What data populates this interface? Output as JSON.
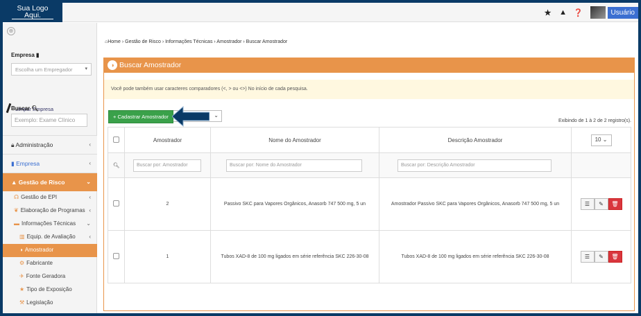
{
  "topbar": {
    "logo_line1": "Sua Logo",
    "logo_line2": "Aqui.",
    "icons": [
      "star-icon",
      "warning-icon",
      "help-icon"
    ],
    "user_label": "Usuário"
  },
  "sidebar": {
    "empresa_label": "Empresa",
    "empresa_select": "Escolha um Empregador",
    "limpar_label": "Limpar Empresa",
    "buscar_label": "Buscar",
    "buscar_placeholder": "Exemplo: Exame Clínico",
    "menu": {
      "admin": "Administração",
      "empresa": "Empresa",
      "gestao": "Gestão de Risco"
    },
    "submenu": [
      {
        "label": "Gestão de EPI",
        "icon": "headset-icon"
      },
      {
        "label": "Elaboração de Programas",
        "icon": "leaf-icon"
      },
      {
        "label": "Informações Técnicas",
        "icon": "folder-icon"
      },
      {
        "label": "Equip. de Avaliação",
        "icon": "chart-icon"
      },
      {
        "label": "Amostrador",
        "icon": "half-circle-icon"
      },
      {
        "label": "Fabricante",
        "icon": "cogs-icon"
      },
      {
        "label": "Fonte Geradora",
        "icon": "satellite-icon"
      },
      {
        "label": "Tipo de Exposição",
        "icon": "star-icon"
      },
      {
        "label": "Legislação",
        "icon": "gavel-icon"
      }
    ]
  },
  "breadcrumb": {
    "items": [
      "Home",
      "Gestão de Risco",
      "Informações Técnicas",
      "Amostrador",
      "Buscar Amostrador"
    ],
    "text": "Home › Gestão de Risco › Informações Técnicas › Amostrador › Buscar Amostrador"
  },
  "page": {
    "title": "Buscar Amostrador",
    "tip": "Você pode também usar caracteres comparadores (<, > ou <>) No início de cada pesquisa.",
    "add_button": "+ Cadastrar Amostrador",
    "showing": "Exibindo de 1 à 2 de 2 registro(s).",
    "page_size": "10"
  },
  "table": {
    "columns": [
      "Amostrador",
      "Nome do Amostrador",
      "Descrição Amostrador"
    ],
    "search_placeholders": [
      "Buscar por: Amostrador",
      "Buscar por: Nome do Amostrador",
      "Buscar por: Descrição Amostrador"
    ],
    "rows": [
      {
        "id": "2",
        "nome": "Passivo SKC para Vapores Orgânicos, Anasorb 747 500 mg, 5 un",
        "descricao": "Amostrador Passivo SKC para Vapores Orgânicos, Anasorb 747 500 mg, 5 un"
      },
      {
        "id": "1",
        "nome": "Tubos XAD-8 de 100 mg ligados em série referência SKC 226-30-08",
        "descricao": "Tubos XAD-8 de 100 mg ligados em série referência SKC 226-30-08"
      }
    ]
  },
  "colors": {
    "accent": "#e8944a",
    "primary": "#0a3a66",
    "success": "#3aa14a",
    "danger": "#d9363e"
  }
}
